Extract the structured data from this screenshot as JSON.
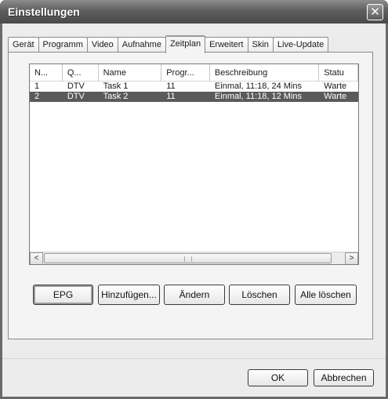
{
  "window": {
    "title": "Einstellungen",
    "close_glyph": "✕",
    "close_icon": "close-icon"
  },
  "tabs": [
    {
      "label": "Gerät",
      "active": false
    },
    {
      "label": "Programm",
      "active": false
    },
    {
      "label": "Video",
      "active": false
    },
    {
      "label": "Aufnahme",
      "active": false
    },
    {
      "label": "Zeitplan",
      "active": true
    },
    {
      "label": "Erweitert",
      "active": false
    },
    {
      "label": "Skin",
      "active": false
    },
    {
      "label": "Live-Update",
      "active": false
    }
  ],
  "schedule": {
    "columns": [
      "N...",
      "Q...",
      "Name",
      "Progr...",
      "Beschreibung",
      "Statu"
    ],
    "rows": [
      {
        "cells": [
          "1",
          "DTV",
          "Task 1",
          "11",
          "Einmal, 11:18, 24 Mins",
          "Warte"
        ],
        "selected": false
      },
      {
        "cells": [
          "2",
          "DTV",
          "Task 2",
          "11",
          "Einmal, 11:18, 12 Mins",
          "Warte"
        ],
        "selected": true
      }
    ],
    "scroll_left_glyph": "<",
    "scroll_right_glyph": ">"
  },
  "actions": {
    "epg": "EPG",
    "add": "Hinzufügen...",
    "edit": "Ändern",
    "delete": "Löschen",
    "delete_all": "Alle löschen"
  },
  "footer": {
    "ok": "OK",
    "cancel": "Abbrechen"
  },
  "colors": {
    "titlebar": "#5e5e5e",
    "selection": "#5a5a5a",
    "dialog_bg": "#ececec"
  }
}
